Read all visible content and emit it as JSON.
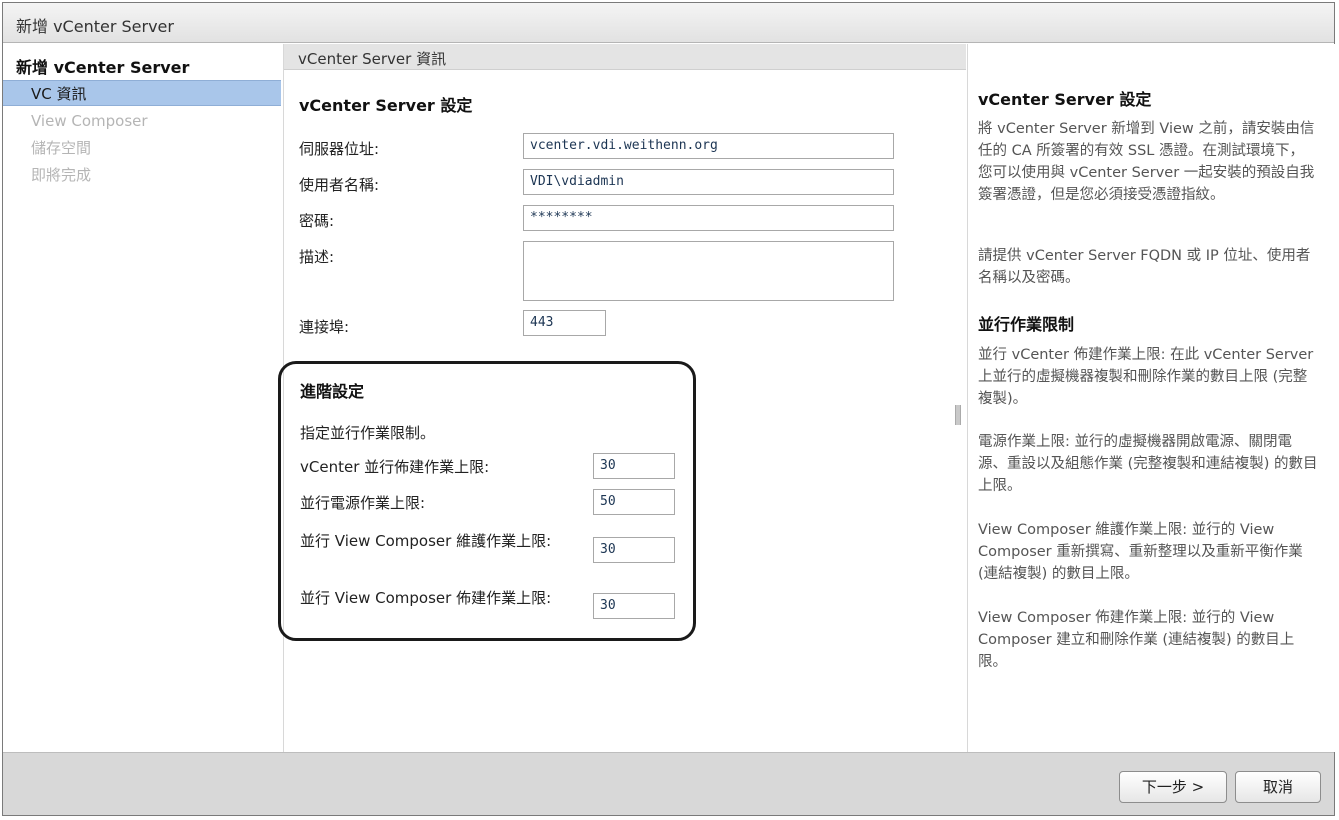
{
  "window": {
    "title": "新增 vCenter Server"
  },
  "sidebar": {
    "heading": "新增 vCenter Server",
    "items": [
      {
        "label": "VC 資訊",
        "state": "active"
      },
      {
        "label": "View Composer",
        "state": "disabled"
      },
      {
        "label": "儲存空間",
        "state": "disabled"
      },
      {
        "label": "即將完成",
        "state": "disabled"
      }
    ]
  },
  "main": {
    "section_title": "vCenter Server 資訊",
    "settings_title": "vCenter Server 設定",
    "fields": {
      "server_address": {
        "label": "伺服器位址:",
        "value": "vcenter.vdi.weithenn.org"
      },
      "username": {
        "label": "使用者名稱:",
        "value": "VDI\\vdiadmin"
      },
      "password": {
        "label": "密碼:",
        "value": "********"
      },
      "description": {
        "label": "描述:",
        "value": ""
      },
      "port": {
        "label": "連接埠:",
        "value": "443"
      }
    },
    "advanced": {
      "title": "進階設定",
      "description": "指定並行作業限制。",
      "limits": [
        {
          "label": "vCenter 並行佈建作業上限:",
          "value": "30"
        },
        {
          "label": "並行電源作業上限:",
          "value": "50"
        },
        {
          "label": "並行 View Composer 維護作業上限:",
          "value": "30"
        },
        {
          "label": "並行 View Composer 佈建作業上限:",
          "value": "30"
        }
      ]
    }
  },
  "help": {
    "settings_title": "vCenter Server 設定",
    "settings_p1": "將 vCenter Server 新增到 View 之前，請安裝由信任的 CA 所簽署的有效 SSL 憑證。在測試環境下，您可以使用與 vCenter Server 一起安裝的預設自我簽署憑證，但是您必須接受憑證指紋。",
    "settings_p2": "請提供 vCenter Server FQDN 或 IP 位址、使用者名稱以及密碼。",
    "limits_title": "並行作業限制",
    "limits_p1": "並行 vCenter 佈建作業上限: 在此 vCenter Server 上並行的虛擬機器複製和刪除作業的數目上限 (完整複製)。",
    "limits_p2": "電源作業上限: 並行的虛擬機器開啟電源、關閉電源、重設以及組態作業 (完整複製和連結複製) 的數目上限。",
    "limits_p3": "View Composer 維護作業上限: 並行的 View Composer 重新撰寫、重新整理以及重新平衡作業 (連結複製) 的數目上限。",
    "limits_p4": "View Composer 佈建作業上限: 並行的 View Composer 建立和刪除作業 (連結複製) 的數目上限。"
  },
  "footer": {
    "next_label": "下一步 >",
    "cancel_label": "取消"
  }
}
